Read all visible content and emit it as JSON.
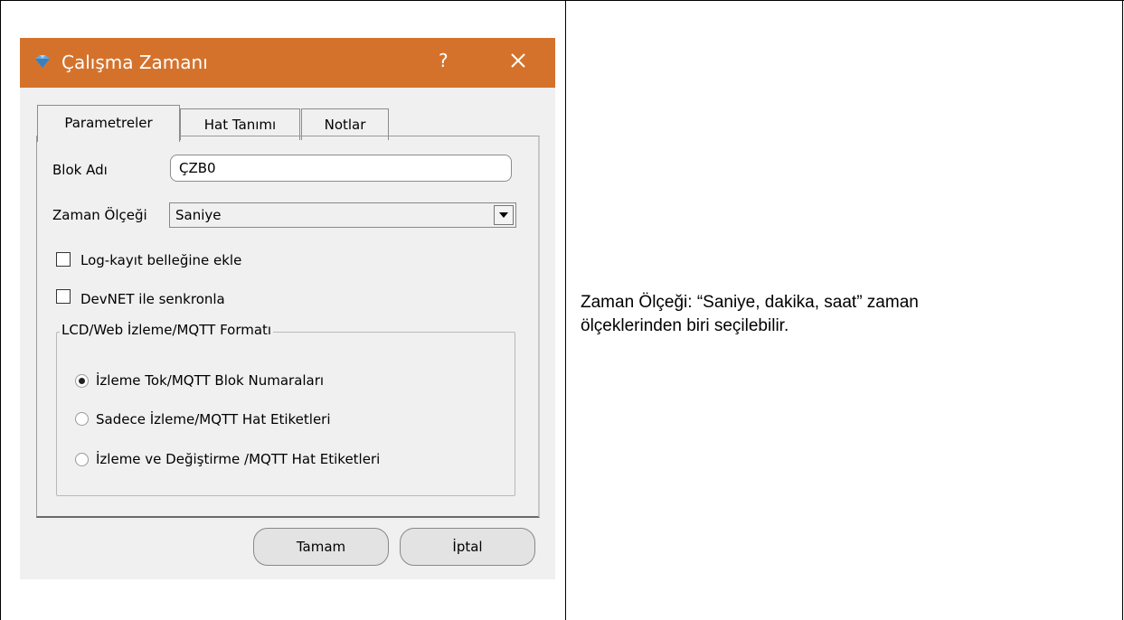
{
  "dialog": {
    "title": "Çalışma Zamanı",
    "help_label": "?",
    "tabs": [
      {
        "label": "Parametreler",
        "active": true
      },
      {
        "label": "Hat Tanımı",
        "active": false
      },
      {
        "label": "Notlar",
        "active": false
      }
    ],
    "block_name": {
      "label": "Blok Adı",
      "value": "ÇZB0"
    },
    "time_scale": {
      "label": "Zaman Ölçeği",
      "value": "Saniye"
    },
    "checkboxes": [
      {
        "label": "Log-kayıt belleğine ekle",
        "checked": false
      },
      {
        "label": "DevNET ile senkronla",
        "checked": false
      }
    ],
    "group": {
      "title": "LCD/Web İzleme/MQTT Formatı",
      "options": [
        {
          "label": "İzleme Tok/MQTT Blok Numaraları",
          "selected": true
        },
        {
          "label": "Sadece İzleme/MQTT Hat Etiketleri",
          "selected": false
        },
        {
          "label": "İzleme ve Değiştirme /MQTT Hat Etiketleri",
          "selected": false
        }
      ]
    },
    "ok_label": "Tamam",
    "cancel_label": "İptal"
  },
  "description": {
    "line1": "Zaman Ölçeği:  “Saniye, dakika, saat” zaman",
    "line2": "ölçeklerinden biri seçilebilir."
  },
  "colors": {
    "titlebar": "#d4722c",
    "dialog_bg": "#f0f0f0"
  },
  "icons": {
    "app": "app-icon",
    "close": "close-icon",
    "dropdown": "dropdown-arrow-icon"
  }
}
